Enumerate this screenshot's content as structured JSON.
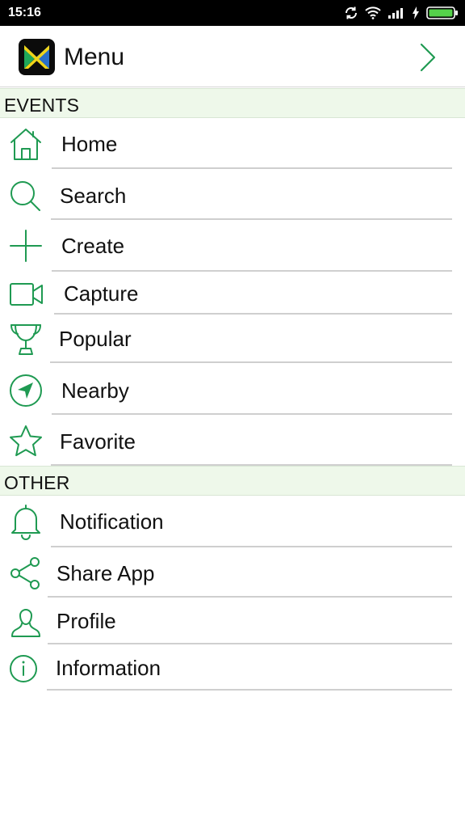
{
  "status_bar": {
    "time": "15:16",
    "icons": [
      "sync-icon",
      "wifi-icon",
      "signal-icon",
      "charging-icon",
      "battery-icon"
    ]
  },
  "header": {
    "title": "Menu",
    "logo_icon": "app-logo-icon",
    "next_icon": "chevron-right-icon"
  },
  "colors": {
    "accent": "#1f9a52",
    "section_bg": "#eef8ea",
    "status_bar": "#000000",
    "battery": "#55d14a"
  },
  "sections": [
    {
      "title": "EVENTS",
      "items": [
        {
          "label": "Home",
          "icon": "home-icon"
        },
        {
          "label": "Search",
          "icon": "search-icon"
        },
        {
          "label": "Create",
          "icon": "plus-icon"
        },
        {
          "label": "Capture",
          "icon": "video-camera-icon"
        },
        {
          "label": "Popular",
          "icon": "trophy-icon"
        },
        {
          "label": "Nearby",
          "icon": "navigation-icon"
        },
        {
          "label": "Favorite",
          "icon": "star-icon"
        }
      ]
    },
    {
      "title": "OTHER",
      "items": [
        {
          "label": "Notification",
          "icon": "bell-icon"
        },
        {
          "label": "Share App",
          "icon": "share-icon"
        },
        {
          "label": "Profile",
          "icon": "user-icon"
        },
        {
          "label": "Information",
          "icon": "info-icon"
        }
      ]
    }
  ]
}
